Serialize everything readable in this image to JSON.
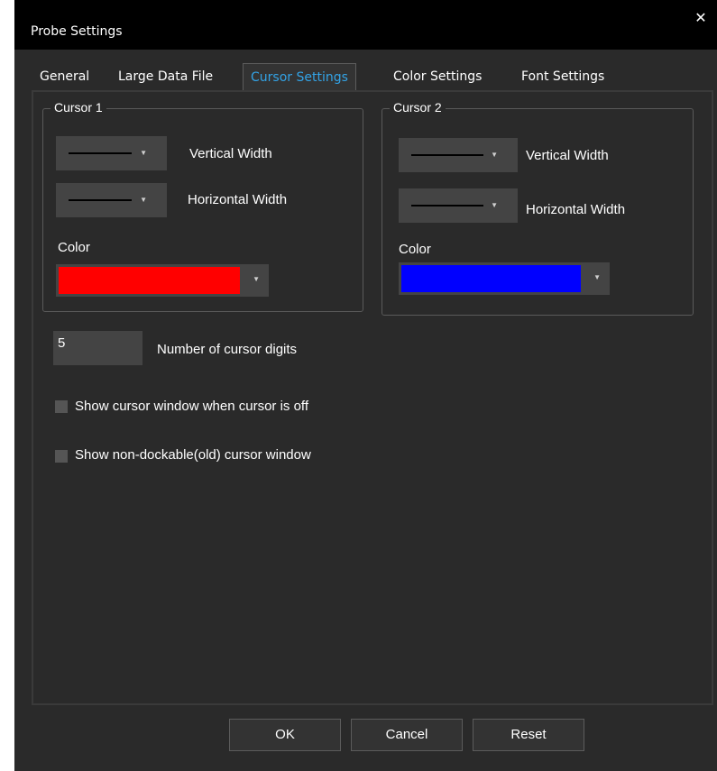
{
  "window": {
    "title": "Probe Settings",
    "close_glyph": "✕"
  },
  "tabs": [
    {
      "label": "General"
    },
    {
      "label": "Large Data File"
    },
    {
      "label": "Cursor Settings",
      "active": true
    },
    {
      "label": "Color Settings"
    },
    {
      "label": "Font Settings"
    }
  ],
  "cursor1": {
    "legend": "Cursor 1",
    "vertical_label": "Vertical Width",
    "horizontal_label": "Horizontal Width",
    "color_label": "Color",
    "color_value": "#ff0000"
  },
  "cursor2": {
    "legend": "Cursor 2",
    "vertical_label": "Vertical Width",
    "horizontal_label": "Horizontal Width",
    "color_label": "Color",
    "color_value": "#0000ff"
  },
  "digits": {
    "value": "5",
    "label": "Number of cursor digits"
  },
  "options": [
    {
      "label": "Show cursor window when cursor is off",
      "checked": false
    },
    {
      "label": "Show non-dockable(old) cursor window",
      "checked": false
    }
  ],
  "buttons": {
    "ok": "OK",
    "cancel": "Cancel",
    "reset": "Reset"
  },
  "colors": {
    "accent": "#33a3e6",
    "background": "#2a2a2a",
    "titlebar": "#000000"
  }
}
